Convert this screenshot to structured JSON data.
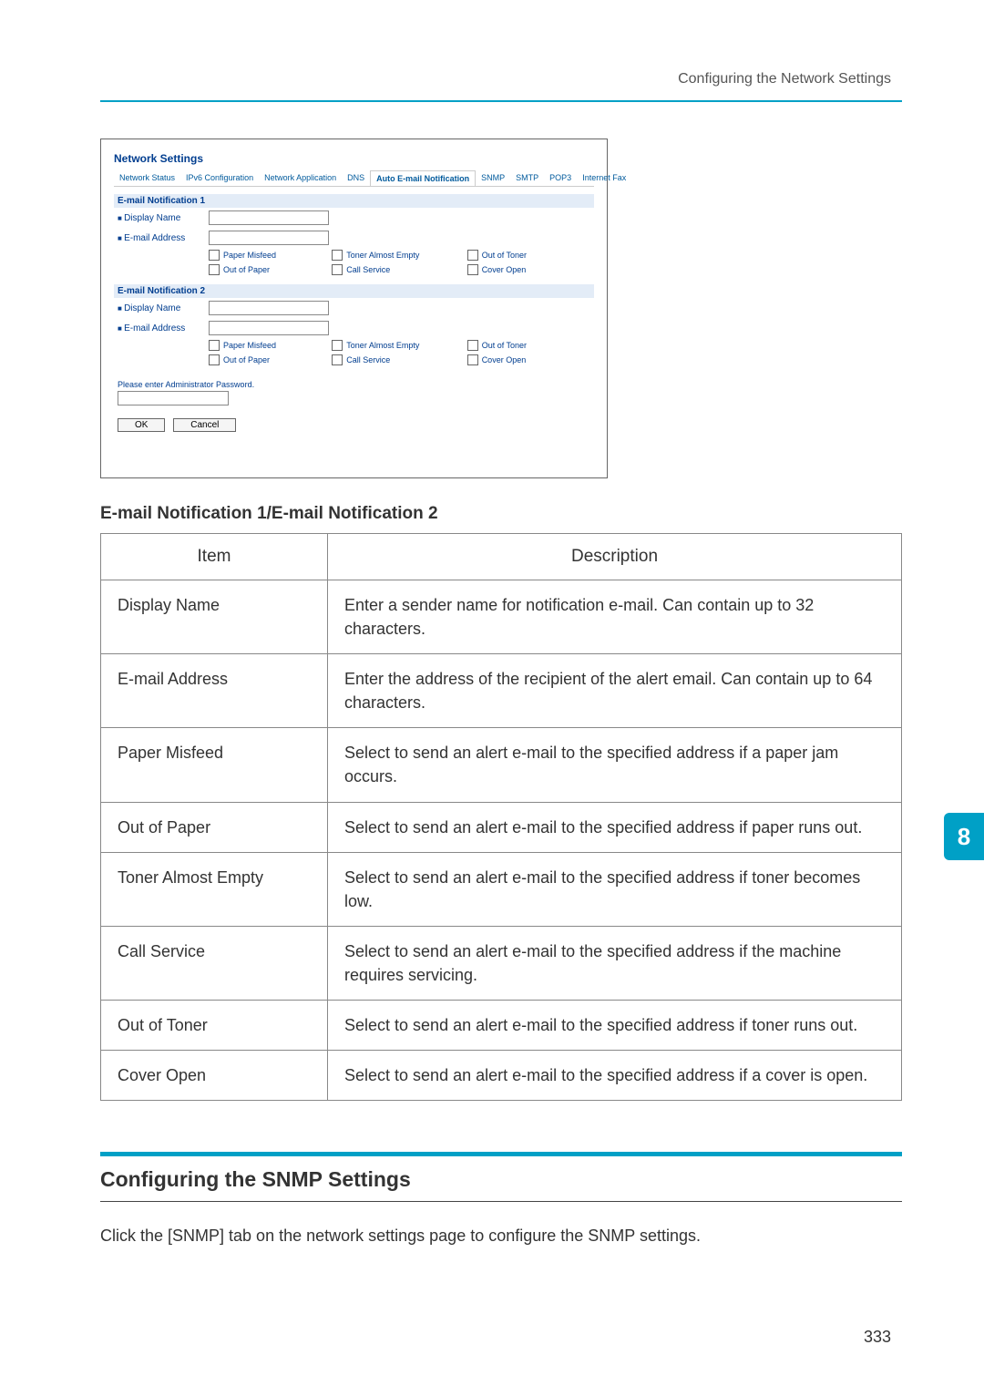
{
  "header": {
    "breadcrumb": "Configuring the Network Settings"
  },
  "screenshot": {
    "windowTitle": "Network Settings",
    "tabs": [
      "Network Status",
      "IPv6 Configuration",
      "Network Application",
      "DNS",
      "Auto E-mail Notification",
      "SNMP",
      "SMTP",
      "POP3",
      "Internet Fax"
    ],
    "activeTab": "Auto E-mail Notification",
    "section1": {
      "title": "E-mail Notification 1",
      "displayNameLabel": "Display Name",
      "emailAddressLabel": "E-mail Address",
      "checks": [
        [
          "Paper Misfeed",
          "Toner Almost Empty",
          "Out of Toner"
        ],
        [
          "Out of Paper",
          "Call Service",
          "Cover Open"
        ]
      ]
    },
    "section2": {
      "title": "E-mail Notification 2",
      "displayNameLabel": "Display Name",
      "emailAddressLabel": "E-mail Address",
      "checks": [
        [
          "Paper Misfeed",
          "Toner Almost Empty",
          "Out of Toner"
        ],
        [
          "Out of Paper",
          "Call Service",
          "Cover Open"
        ]
      ]
    },
    "passwordNote": "Please enter Administrator Password.",
    "buttons": {
      "ok": "OK",
      "cancel": "Cancel"
    }
  },
  "tableTitle": "E-mail Notification 1/E-mail Notification 2",
  "table": {
    "headers": [
      "Item",
      "Description"
    ],
    "rows": [
      [
        "Display Name",
        "Enter a sender name for notification e-mail. Can contain up to 32 characters."
      ],
      [
        "E-mail Address",
        "Enter the address of the recipient of the alert email. Can contain up to 64 characters."
      ],
      [
        "Paper Misfeed",
        "Select to send an alert e-mail to the specified address if a paper jam occurs."
      ],
      [
        "Out of Paper",
        "Select to send an alert e-mail to the specified address if paper runs out."
      ],
      [
        "Toner Almost Empty",
        "Select to send an alert e-mail to the specified address if toner becomes low."
      ],
      [
        "Call Service",
        "Select to send an alert e-mail to the specified address if the machine requires servicing."
      ],
      [
        "Out of Toner",
        "Select to send an alert e-mail to the specified address if toner runs out."
      ],
      [
        "Cover Open",
        "Select to send an alert e-mail to the specified address if a cover is open."
      ]
    ]
  },
  "snmpSection": {
    "heading": "Configuring the SNMP Settings",
    "body": "Click the [SNMP] tab on the network settings page to configure the SNMP settings."
  },
  "chapterTab": "8",
  "pageNumber": "333"
}
